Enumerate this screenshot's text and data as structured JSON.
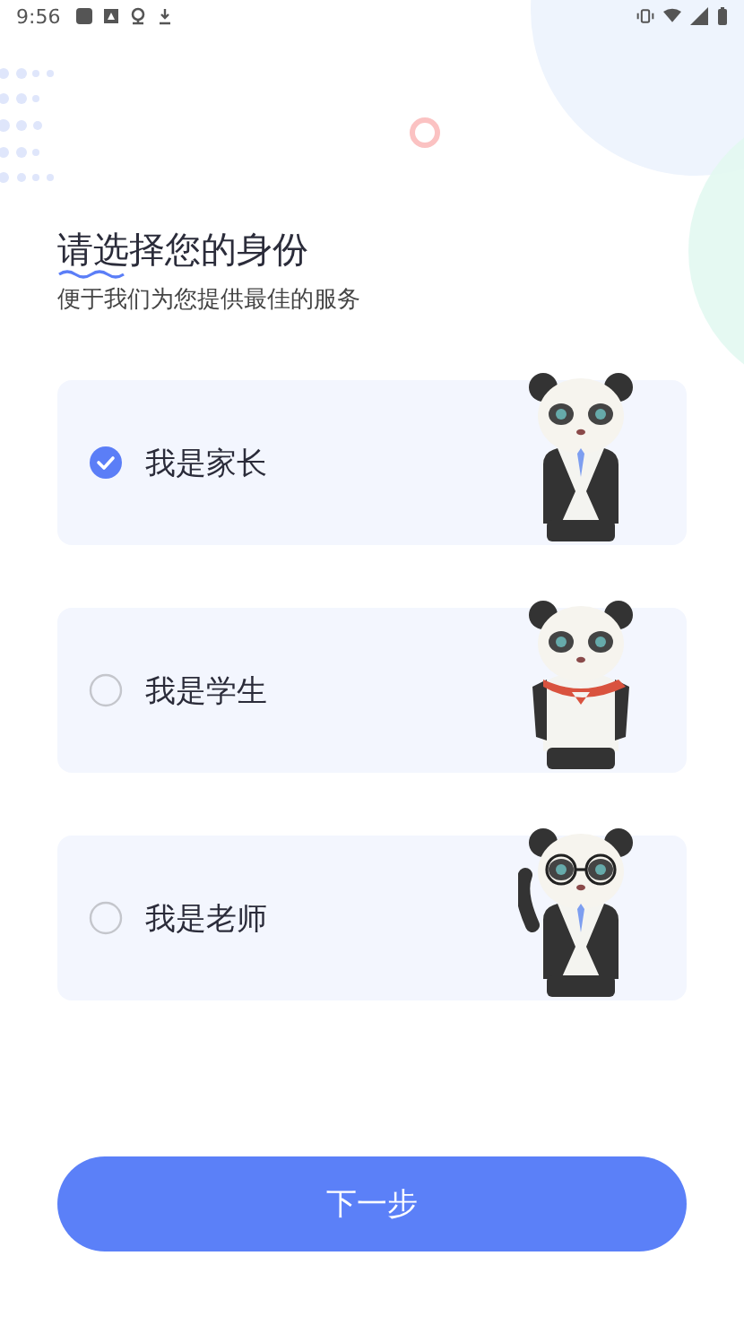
{
  "status_bar": {
    "time": "9:56"
  },
  "heading": {
    "title": "请选择您的身份",
    "subtitle": "便于我们为您提供最佳的服务"
  },
  "roles": [
    {
      "label": "我是家长",
      "kind": "parent",
      "selected": true
    },
    {
      "label": "我是学生",
      "kind": "student",
      "selected": false
    },
    {
      "label": "我是老师",
      "kind": "teacher",
      "selected": false
    }
  ],
  "next_button": "下一步"
}
